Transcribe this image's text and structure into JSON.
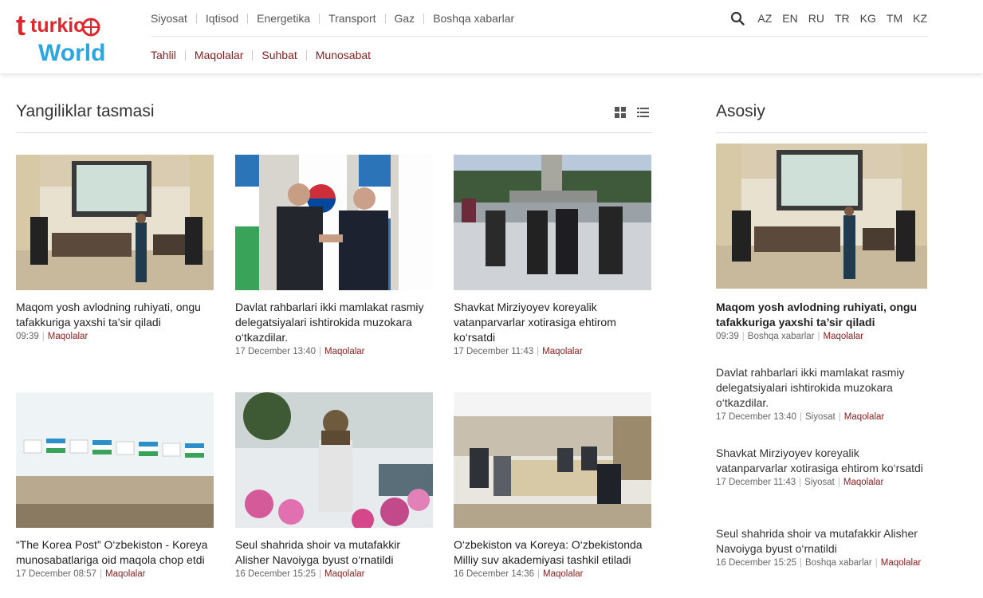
{
  "brand": {
    "logo_top": "turkic",
    "logo_bottom": "World"
  },
  "nav_primary": [
    "Siyosat",
    "Iqtisod",
    "Energetika",
    "Transport",
    "Gaz",
    "Boshqa xabarlar"
  ],
  "nav_secondary": [
    "Tahlil",
    "Maqolalar",
    "Suhbat",
    "Munosabat"
  ],
  "languages": [
    "AZ",
    "EN",
    "RU",
    "TR",
    "KG",
    "TM",
    "KZ"
  ],
  "feed": {
    "title": "Yangiliklar tasmasi",
    "cards": [
      {
        "title": "Maqom yosh avlodning ruhiyati, ongu tafakkuriga yaxshi ta’sir qiladi",
        "time": "09:39",
        "category": "Maqolalar",
        "image": "stage-concert-photo"
      },
      {
        "title": "Davlat rahbarlari ikki mamlakat rasmiy delegatsiyalari ishtirokida muzokara o‘tkazdilar.",
        "time": "17 December 13:40",
        "category": "Maqolalar",
        "image": "leaders-fist-bump-photo"
      },
      {
        "title": "Shavkat Mirziyoyev koreyalik vatanparvarlar xotirasiga ehtirom ko‘rsatdi",
        "time": "17 December 11:43",
        "category": "Maqolalar",
        "image": "memorial-walk-photo"
      },
      {
        "title": "“The Korea Post” O‘zbekiston - Koreya munosabatlariga oid maqola chop etdi",
        "time": "17 December 08:57",
        "category": "Maqolalar",
        "image": "flags-building-photo"
      },
      {
        "title": "Seul shahrida shoir va mutafakkir Alisher Navoiyga byust o‘rnatildi",
        "time": "16 December 15:25",
        "category": "Maqolalar",
        "image": "bust-flowers-photo"
      },
      {
        "title": "O‘zbekiston va Koreya: O‘zbekistonda Milliy suv akademiyasi tashkil etiladi",
        "time": "16 December 14:36",
        "category": "Maqolalar",
        "image": "meeting-room-photo"
      }
    ]
  },
  "sidebar": {
    "title": "Asosiy",
    "items": [
      {
        "title": "Maqom yosh avlodning ruhiyati, ongu tafakkuriga yaxshi ta’sir qiladi",
        "time": "09:39",
        "section": "Boshqa xabarlar",
        "category": "Maqolalar"
      },
      {
        "title": "Davlat rahbarlari ikki mamlakat rasmiy delegatsiyalari ishtirokida muzokara o‘tkazdilar.",
        "time": "17 December 13:40",
        "section": "Siyosat",
        "category": "Maqolalar"
      },
      {
        "title": "Shavkat Mirziyoyev koreyalik vatanparvarlar xotirasiga ehtirom ko‘rsatdi",
        "time": "17 December 11:43",
        "section": "Siyosat",
        "category": "Maqolalar"
      },
      {
        "title": "Seul shahrida shoir va mutafakkir Alisher Navoiyga byust o‘rnatildi",
        "time": "16 December 15:25",
        "section": "Boshqa xabarlar",
        "category": "Maqolalar"
      }
    ]
  },
  "colors": {
    "accent": "#8b1c1c",
    "logo_red": "#e0262c",
    "logo_blue": "#2aa7e0"
  }
}
